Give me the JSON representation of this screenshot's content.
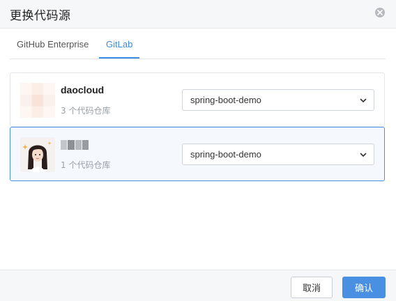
{
  "dialog": {
    "title": "更换代码源",
    "close_icon": "close-circle-icon"
  },
  "tabs": [
    {
      "label": "GitHub Enterprise",
      "active": false
    },
    {
      "label": "GitLab",
      "active": true
    }
  ],
  "accent_color": "#4a90e2",
  "accounts": [
    {
      "name": "daocloud",
      "repo_count": "3 个代码仓库",
      "selected_repo": "spring-boot-demo",
      "selected": false
    },
    {
      "name": "",
      "repo_count": "1 个代码仓库",
      "selected_repo": "spring-boot-demo",
      "selected": true
    }
  ],
  "footer": {
    "cancel_label": "取消",
    "confirm_label": "确认"
  }
}
